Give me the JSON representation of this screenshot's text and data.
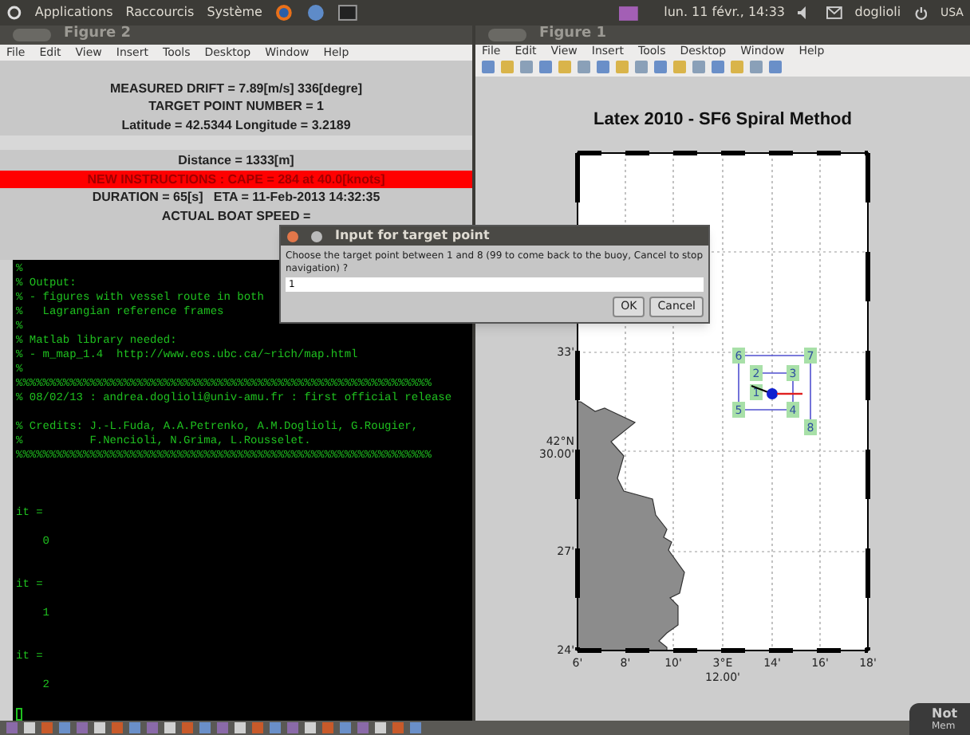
{
  "top_panel": {
    "menus": [
      "Applications",
      "Raccourcis",
      "Système"
    ],
    "clock": "lun. 11 févr., 14:33",
    "user": "doglioli",
    "keyboard": "USA"
  },
  "figure2": {
    "title": "Figure 2",
    "menu": [
      "File",
      "Edit",
      "View",
      "Insert",
      "Tools",
      "Desktop",
      "Window",
      "Help"
    ],
    "info_lines": [
      {
        "text": "MEASURED DRIFT = 7.89[m/s] 336[degre]",
        "kind": "plain"
      },
      {
        "text": "TARGET POINT NUMBER = 1",
        "kind": "plain"
      },
      {
        "text": "Latitude = 42.5344 Longitude = 3.2189",
        "kind": "plain"
      },
      {
        "kind": "band"
      },
      {
        "text": "Distance = 1333[m]",
        "kind": "plain"
      },
      {
        "text": "NEW INSTRUCTIONS : CAPE = 284 at 40.0[knots]",
        "kind": "alert"
      },
      {
        "text": "DURATION = 65[s]   ETA = 11-Feb-2013 14:32:35",
        "kind": "plain"
      },
      {
        "text": "ACTUAL BOAT SPEED =",
        "kind": "plain"
      }
    ]
  },
  "terminal": {
    "lines": [
      {
        "kind": "text",
        "text": "%"
      },
      {
        "kind": "text",
        "text": "% Output:"
      },
      {
        "kind": "text",
        "text": "% - figures with vessel route in both"
      },
      {
        "kind": "text",
        "text": "%   Lagrangian reference frames"
      },
      {
        "kind": "text",
        "text": "%"
      },
      {
        "kind": "text",
        "text": "% Matlab library needed:"
      },
      {
        "kind": "text",
        "text": "% - m_map_1.4  http://www.eos.ubc.ca/~rich/map.html"
      },
      {
        "kind": "text",
        "text": "%"
      },
      {
        "kind": "text",
        "text": "%%%%%%%%%%%%%%%%%%%%%%%%%%%%%%%%%%%%%%%%%%%%%%%%%%%%%%%%%%%%%%"
      },
      {
        "kind": "text",
        "text": "% 08/02/13 : andrea.doglioli@univ-amu.fr : first official release"
      },
      {
        "kind": "blank"
      },
      {
        "kind": "text",
        "text": "% Credits: J.-L.Fuda, A.A.Petrenko, A.M.Doglioli, G.Rougier,"
      },
      {
        "kind": "text",
        "text": "%          F.Nencioli, N.Grima, L.Rousselet."
      },
      {
        "kind": "text",
        "text": "%%%%%%%%%%%%%%%%%%%%%%%%%%%%%%%%%%%%%%%%%%%%%%%%%%%%%%%%%%%%%%"
      },
      {
        "kind": "blank"
      },
      {
        "kind": "blank"
      },
      {
        "kind": "blank"
      },
      {
        "kind": "text",
        "text": "it ="
      },
      {
        "kind": "blank"
      },
      {
        "kind": "text",
        "text": "    0"
      },
      {
        "kind": "blank"
      },
      {
        "kind": "blank"
      },
      {
        "kind": "text",
        "text": "it ="
      },
      {
        "kind": "blank"
      },
      {
        "kind": "text",
        "text": "    1"
      },
      {
        "kind": "blank"
      },
      {
        "kind": "blank"
      },
      {
        "kind": "text",
        "text": "it ="
      },
      {
        "kind": "blank"
      },
      {
        "kind": "text",
        "text": "    2"
      },
      {
        "kind": "blank"
      }
    ]
  },
  "figure1": {
    "title": "Figure 1",
    "menu": [
      "File",
      "Edit",
      "View",
      "Insert",
      "Tools",
      "Desktop",
      "Window",
      "Help"
    ],
    "plot_title": "Latex 2010 - SF6 Spiral Method",
    "y_labels": [
      "33'",
      "42°N",
      "30.00'",
      "27'",
      "24'"
    ],
    "x_labels": [
      "6'",
      "8'",
      "10'",
      "3°E",
      "14'",
      "16'",
      "18'"
    ],
    "x_sublabel": "12.00'",
    "waypoints": [
      "1",
      "2",
      "3",
      "4",
      "5",
      "6",
      "7",
      "8"
    ]
  },
  "dialog": {
    "title": "Input for target point",
    "prompt": "Choose the target point between 1 and 8 (99 to come back to the buoy, Cancel to stop navigation) ?",
    "value": "1",
    "buttons": [
      "OK",
      "Cancel"
    ]
  },
  "notification": {
    "title": "Not",
    "text": "Mem"
  }
}
